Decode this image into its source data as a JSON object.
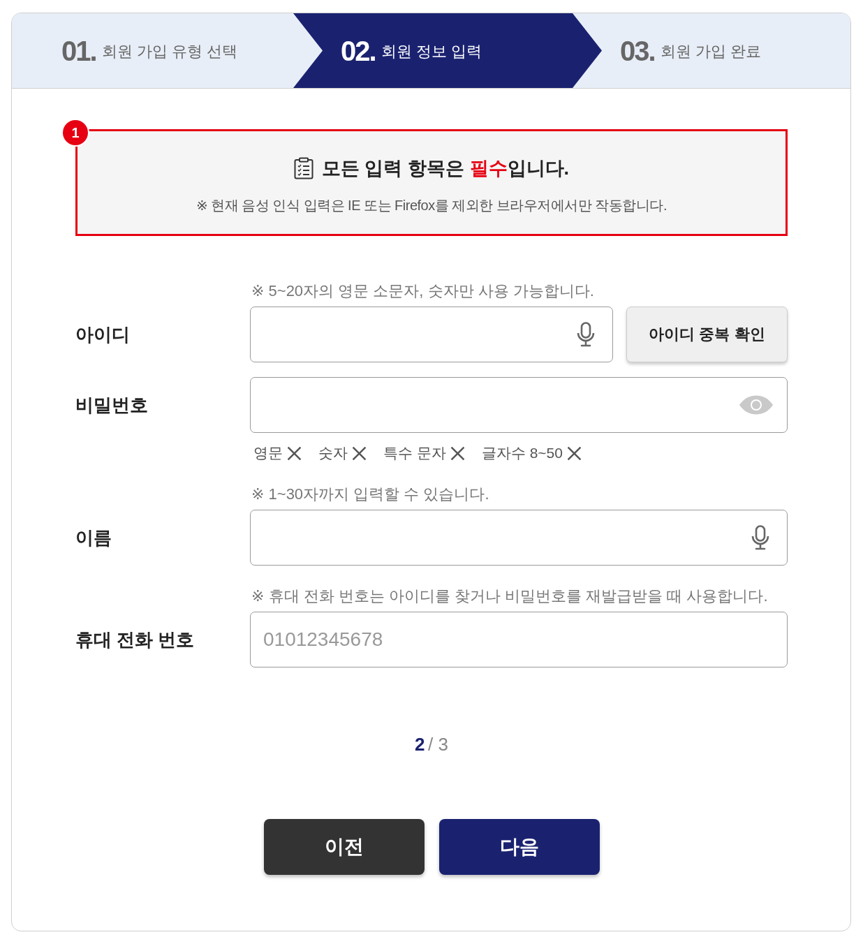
{
  "steps": [
    {
      "number": "01.",
      "label": "회원 가입 유형 선택",
      "selected": false
    },
    {
      "number": "02.",
      "label": "회원 정보 입력",
      "selected": true
    },
    {
      "number": "03.",
      "label": "회원 가입 완료",
      "selected": false
    }
  ],
  "notice": {
    "badge": "1",
    "title_before": "모든 입력 항목은",
    "title_emphasis": "필수",
    "title_after": "입니다.",
    "note": "※ 현재 음성 인식 입력은 IE 또는 Firefox를 제외한 브라우저에서만 작동합니다."
  },
  "fields": [
    {
      "label": "아이디",
      "hint": "※ 5~20자의 영문 소문자, 숫자만 사용 가능합니다.",
      "kind": "voice",
      "button": "아이디 중복 확인"
    },
    {
      "label": "비밀번호",
      "kind": "password",
      "rules": [
        {
          "label": "영문",
          "met": false
        },
        {
          "label": "숫자",
          "met": false
        },
        {
          "label": "특수 문자",
          "met": false
        },
        {
          "label": "글자수 8~50",
          "met": false
        }
      ]
    },
    {
      "label": "이름",
      "hint": "※ 1~30자까지 입력할 수 있습니다.",
      "kind": "voice"
    },
    {
      "label": "휴대 전화 번호",
      "hint": "※ 휴대 전화 번호는 아이디를 찾거나 비밀번호를 재발급받을 때 사용합니다.",
      "kind": "plain",
      "placeholder": "01012345678"
    }
  ],
  "pagination": {
    "current": "2",
    "total": "/ 3"
  },
  "buttons": [
    {
      "label": "이전",
      "kind": "secondary"
    },
    {
      "label": "다음",
      "kind": "primary"
    }
  ]
}
